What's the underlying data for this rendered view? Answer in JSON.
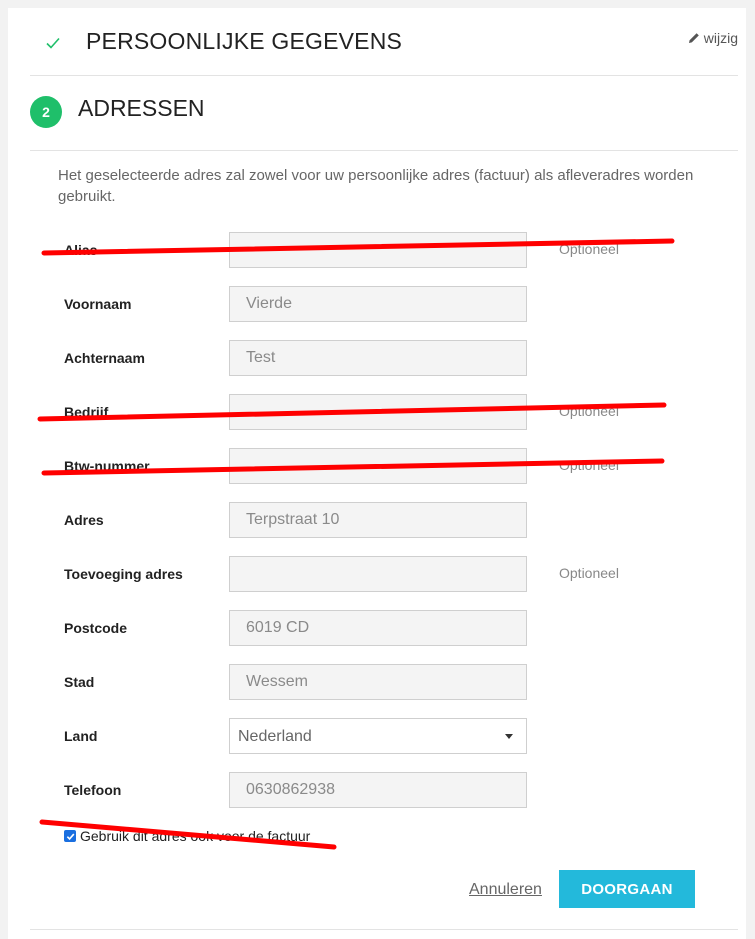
{
  "step1": {
    "title": "PERSOONLIJKE GEGEVENS",
    "edit_label": "wijzig"
  },
  "step2": {
    "number": "2",
    "title": "ADRESSEN",
    "intro": "Het geselecteerde adres zal zowel voor uw persoonlijke adres (factuur) als afleveradres worden gebruikt."
  },
  "form": {
    "alias": {
      "label": "Alias",
      "value": "",
      "optional": "Optioneel"
    },
    "firstname": {
      "label": "Voornaam",
      "value": "Vierde"
    },
    "lastname": {
      "label": "Achternaam",
      "value": "Test"
    },
    "company": {
      "label": "Bedrijf",
      "value": "",
      "optional": "Optioneel"
    },
    "vat": {
      "label": "Btw-nummer",
      "value": "",
      "optional": "Optioneel"
    },
    "address": {
      "label": "Adres",
      "value": "Terpstraat 10"
    },
    "address2": {
      "label": "Toevoeging adres",
      "value": "",
      "optional": "Optioneel"
    },
    "postcode": {
      "label": "Postcode",
      "value": "6019 CD"
    },
    "city": {
      "label": "Stad",
      "value": "Wessem"
    },
    "country": {
      "label": "Land",
      "value": "Nederland"
    },
    "phone": {
      "label": "Telefoon",
      "value": "0630862938"
    },
    "use_for_invoice": {
      "label": "Gebruik dit adres ook voor de factuur",
      "checked": true
    }
  },
  "actions": {
    "cancel": "Annuleren",
    "continue": "DOORGAAN"
  },
  "colors": {
    "success": "#1fbf6a",
    "primary_button": "#23b9db",
    "redaction": "#ff0000"
  }
}
